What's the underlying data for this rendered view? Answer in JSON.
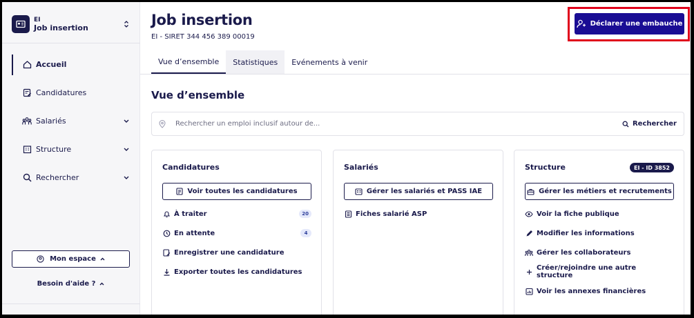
{
  "org": {
    "kind": "EI",
    "name": "Job insertion"
  },
  "nav": [
    {
      "label": "Accueil",
      "icon": "home-icon"
    },
    {
      "label": "Candidatures",
      "icon": "file-edit-icon"
    },
    {
      "label": "Salariés",
      "icon": "team-icon"
    },
    {
      "label": "Structure",
      "icon": "building-icon"
    },
    {
      "label": "Rechercher",
      "icon": "search-icon"
    }
  ],
  "sidebar_footer": {
    "space_label": "Mon espace",
    "help_label": "Besoin d'aide ?"
  },
  "header": {
    "title": "Job insertion",
    "subtitle": "EI - SIRET 344 456 389 00019",
    "declare_label": "Déclarer une embauche"
  },
  "tabs": [
    {
      "label": "Vue d’ensemble"
    },
    {
      "label": "Statistiques"
    },
    {
      "label": "Evénements à venir"
    }
  ],
  "overview": {
    "title": "Vue d’ensemble",
    "search_placeholder": "Rechercher un emploi inclusif autour de...",
    "search_button": "Rechercher"
  },
  "cards": {
    "candidatures": {
      "title": "Candidatures",
      "button": "Voir toutes les candidatures",
      "links": [
        {
          "label": "À traiter",
          "count": "20"
        },
        {
          "label": "En attente",
          "count": "4"
        },
        {
          "label": "Enregistrer une candidature"
        },
        {
          "label": "Exporter toutes les candidatures"
        }
      ]
    },
    "salaries": {
      "title": "Salariés",
      "button": "Gérer les salariés et PASS IAE",
      "links": [
        {
          "label": "Fiches salarié ASP"
        }
      ]
    },
    "structure": {
      "title": "Structure",
      "badge": "EI - ID 3852",
      "button": "Gérer les métiers et recrutements",
      "links": [
        {
          "label": "Voir la fiche publique"
        },
        {
          "label": "Modifier les informations"
        },
        {
          "label": "Gérer les collaborateurs"
        },
        {
          "label": "Créer/rejoindre une autre structure"
        },
        {
          "label": "Voir les annexes financières"
        }
      ]
    }
  },
  "colors": {
    "navy": "#1a1a4b",
    "primary_button": "#1a0d94",
    "highlight": "#e0001b"
  }
}
